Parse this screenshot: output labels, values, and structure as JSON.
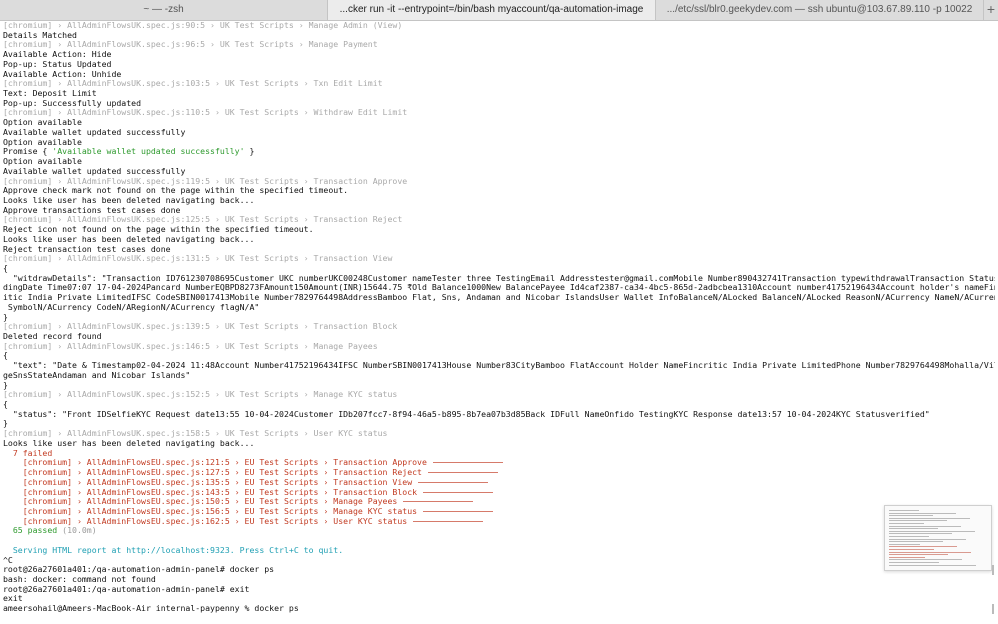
{
  "tabs": [
    {
      "label": "~ — -zsh",
      "active": false
    },
    {
      "label": "...cker run -it --entrypoint=/bin/bash myaccount/qa-automation-image",
      "active": true
    },
    {
      "label": ".../etc/ssl/blr0.geekydev.com — ssh ubuntu@103.67.89.110 -p 10022",
      "active": false
    }
  ],
  "new_tab_label": "+",
  "terminal": {
    "lines": [
      {
        "text": "[chromium] › AllAdminFlowsUK.spec.js:90:5 › UK Test Scripts › Manage Admin (View)",
        "style": "gray"
      },
      {
        "text": "Details Matched",
        "style": "normal"
      },
      {
        "text": "[chromium] › AllAdminFlowsUK.spec.js:96:5 › UK Test Scripts › Manage Payment",
        "style": "gray"
      },
      {
        "text": "Available Action: Hide",
        "style": "normal"
      },
      {
        "text": "Pop-up: Status Updated",
        "style": "normal"
      },
      {
        "text": "Available Action: Unhide",
        "style": "normal"
      },
      {
        "text": "[chromium] › AllAdminFlowsUK.spec.js:103:5 › UK Test Scripts › Txn Edit Limit",
        "style": "gray"
      },
      {
        "text": "Text: Deposit Limit",
        "style": "normal"
      },
      {
        "text": "Pop-up: Successfully updated",
        "style": "normal"
      },
      {
        "text": "[chromium] › AllAdminFlowsUK.spec.js:110:5 › UK Test Scripts › Withdraw Edit Limit",
        "style": "gray"
      },
      {
        "text": "Option available",
        "style": "normal"
      },
      {
        "text": "Available wallet updated successfully",
        "style": "normal"
      },
      {
        "text": "Option available",
        "style": "normal"
      },
      {
        "text": "Promise { ",
        "style": "normal",
        "str": "'Available wallet updated successfully'",
        "tail": " }"
      },
      {
        "text": "Option available",
        "style": "normal"
      },
      {
        "text": "Available wallet updated successfully",
        "style": "normal"
      },
      {
        "text": "[chromium] › AllAdminFlowsUK.spec.js:119:5 › UK Test Scripts › Transaction Approve",
        "style": "gray"
      },
      {
        "text": "Approve check mark not found on the page within the specified timeout.",
        "style": "normal"
      },
      {
        "text": "Looks like user has been deleted navigating back...",
        "style": "normal"
      },
      {
        "text": "Approve transactions test cases done",
        "style": "normal"
      },
      {
        "text": "[chromium] › AllAdminFlowsUK.spec.js:125:5 › UK Test Scripts › Transaction Reject",
        "style": "gray"
      },
      {
        "text": "Reject icon not found on the page within the specified timeout.",
        "style": "normal"
      },
      {
        "text": "Looks like user has been deleted navigating back...",
        "style": "normal"
      },
      {
        "text": "Reject transaction test cases done",
        "style": "normal"
      },
      {
        "text": "[chromium] › AllAdminFlowsUK.spec.js:131:5 › UK Test Scripts › Transaction View",
        "style": "gray"
      },
      {
        "text": "{",
        "style": "normal"
      },
      {
        "text": "  \"witdrawDetails\": \"Transaction ID761230708695Customer UKC numberUKC00248Customer nameTester three TestingEmail Addresstester@gmail.comMobile Number890432741Transaction typewithdrawalTransaction Statuspen",
        "style": "normal"
      },
      {
        "text": "dingDate Time07:07 17-04-2024Pancard NumberEQBPD8273FAmount150Amount(INR)15644.75 ₹Old Balance1000New BalancePayee Id4caf2387-ca34-4bc5-865d-2adbcbea1310Account number41752196434Account holder's nameFincr",
        "style": "normal"
      },
      {
        "text": "itic India Private LimitedIFSC CodeSBIN0017413Mobile Number7829764498AddressBamboo Flat, Sns, Andaman and Nicobar IslandsUser Wallet InfoBalanceN/ALocked BalanceN/ALocked ReasonN/ACurrency NameN/ACurrency",
        "style": "normal"
      },
      {
        "text": " SymbolN/ACurrency CodeN/ARegionN/ACurrency flagN/A\"",
        "style": "normal"
      },
      {
        "text": "}",
        "style": "normal"
      },
      {
        "text": "[chromium] › AllAdminFlowsUK.spec.js:139:5 › UK Test Scripts › Transaction Block",
        "style": "gray"
      },
      {
        "text": "Deleted record found",
        "style": "normal"
      },
      {
        "text": "[chromium] › AllAdminFlowsUK.spec.js:146:5 › UK Test Scripts › Manage Payees",
        "style": "gray"
      },
      {
        "text": "{",
        "style": "normal"
      },
      {
        "text": "  \"text\": \"Date & Timestamp02-04-2024 11:48Account Number41752196434IFSC NumberSBIN0017413House Number83CityBamboo FlatAccount Holder NameFincritic India Private LimitedPhone Number7829764498Mohalla/Villa",
        "style": "normal"
      },
      {
        "text": "geSnsStateAndaman and Nicobar Islands\"",
        "style": "normal"
      },
      {
        "text": "}",
        "style": "normal"
      },
      {
        "text": "[chromium] › AllAdminFlowsUK.spec.js:152:5 › UK Test Scripts › Manage KYC status",
        "style": "gray"
      },
      {
        "text": "{",
        "style": "normal"
      },
      {
        "text": "  \"status\": \"Front IDSelfieKYC Request date13:55 10-04-2024Customer IDb207fcc7-8f94-46a5-b895-8b7ea07b3d85Back IDFull NameOnfido TestingKYC Response date13:57 10-04-2024KYC Statusverified\"",
        "style": "normal"
      },
      {
        "text": "}",
        "style": "normal"
      },
      {
        "text": "[chromium] › AllAdminFlowsUK.spec.js:158:5 › UK Test Scripts › User KYC status",
        "style": "gray"
      },
      {
        "text": "Looks like user has been deleted navigating back...",
        "style": "normal"
      },
      {
        "text": "  7 failed",
        "style": "red"
      },
      {
        "text": "    [chromium] › AllAdminFlowsEU.spec.js:121:5 › EU Test Scripts › Transaction Approve",
        "style": "red",
        "dash": true
      },
      {
        "text": "    [chromium] › AllAdminFlowsEU.spec.js:127:5 › EU Test Scripts › Transaction Reject",
        "style": "red",
        "dash": true
      },
      {
        "text": "    [chromium] › AllAdminFlowsEU.spec.js:135:5 › EU Test Scripts › Transaction View",
        "style": "red",
        "dash": true
      },
      {
        "text": "    [chromium] › AllAdminFlowsEU.spec.js:143:5 › EU Test Scripts › Transaction Block",
        "style": "red",
        "dash": true
      },
      {
        "text": "    [chromium] › AllAdminFlowsEU.spec.js:150:5 › EU Test Scripts › Manage Payees",
        "style": "red",
        "dash": true
      },
      {
        "text": "    [chromium] › AllAdminFlowsEU.spec.js:156:5 › EU Test Scripts › Manage KYC status",
        "style": "red",
        "dash": true
      },
      {
        "text": "    [chromium] › AllAdminFlowsEU.spec.js:162:5 › EU Test Scripts › User KYC status",
        "style": "red",
        "dash": true
      },
      {
        "text": "  65 passed",
        "style": "green",
        "dim": " (10.0m)"
      },
      {
        "text": "",
        "style": "normal"
      },
      {
        "text": "  Serving HTML report at http://localhost:9323. Press Ctrl+C to quit.",
        "style": "cyan"
      },
      {
        "text": "^C",
        "style": "normal"
      },
      {
        "text": "root@26a27601a401:/qa-automation-admin-panel# docker ps",
        "style": "normal"
      },
      {
        "text": "bash: docker: command not found",
        "style": "normal"
      },
      {
        "text": "root@26a27601a401:/qa-automation-admin-panel# exit",
        "style": "normal"
      },
      {
        "text": "exit",
        "style": "normal"
      },
      {
        "text": "ameersohail@Ameers-MacBook-Air internal-paypenny % docker ps",
        "style": "normal"
      }
    ]
  }
}
